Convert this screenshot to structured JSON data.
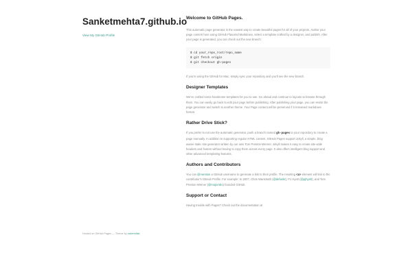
{
  "sidebar": {
    "title": "Sanketmehta7.github.io",
    "profile_link": "View My GitHub Profile"
  },
  "footer": {
    "prefix": "Hosted on GitHub Pages — Theme by ",
    "theme_author": "orderedlist"
  },
  "welcome": {
    "heading": "Welcome to GitHub Pages.",
    "intro": "This automatic page generator is the easiest way to create beautiful pages for all of your projects. Author your page content here using GitHub Flavored Markdown, select a template crafted by a designer, and publish. After your page is generated, you can check out the new branch:",
    "code": "$ cd your_repo_root/repo_name\n$ git fetch origin\n$ git checkout gh-pages",
    "after": "If you're using the GitHub for Mac, simply sync your repository and you'll see the new branch."
  },
  "designer": {
    "heading": "Designer Templates",
    "text": "We've crafted some handsome templates for you to use. Go ahead and continue to layouts to browse through them. You can easily go back to edit your page before publishing. After publishing your page, you can revisit the page generator and switch to another theme. Your Page content will be preserved if it remained markdown format."
  },
  "drive": {
    "heading": "Rather Drive Stick?",
    "text_before": "If you prefer to not use the automatic generator, push a branch named ",
    "branch": "gh-pages",
    "text_after": " to your repository to create a page manually. In addition to supporting regular HTML content, GitHub Pages support Jekyll, a simple, blog aware static site generator written by our own Tom Preston-Werner. Jekyll makes it easy to create site-wide headers and footers without having to copy them across every page. It also offers intelligent blog support and other advanced templating features."
  },
  "authors": {
    "heading": "Authors and Contributors",
    "t1": "You can ",
    "mention": "@mention",
    "t2": " a GitHub username to generate a link to their profile. The resulting ",
    "tag": "<a>",
    "t3": " element will link to the contributor's GitHub Profile. For example: In 2007, Chris Wanstrath (",
    "u1": "@defunkt",
    "t4": "), PJ Hyett (",
    "u2": "@pjhyett",
    "t5": "), and Tom Preston-Werner (",
    "u3": "@mojombo",
    "t6": ") founded GitHub."
  },
  "support": {
    "heading": "Support or Contact",
    "text": "Having trouble with Pages? Check out the documentation at"
  }
}
